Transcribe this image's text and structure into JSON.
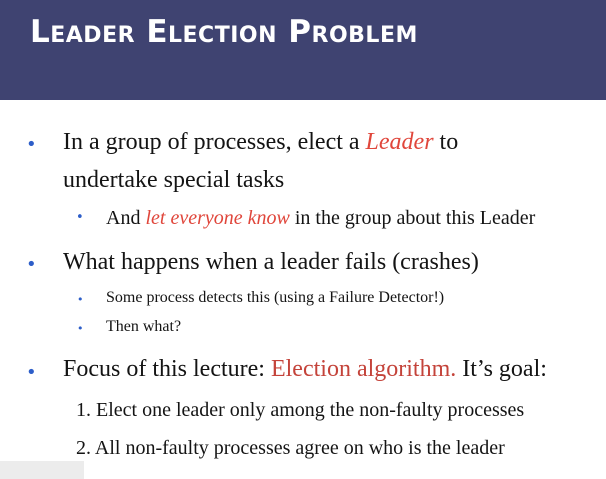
{
  "slide": {
    "title": "Leader Election Problem",
    "bullets": [
      {
        "line1_pre": "In a group of processes, elect a ",
        "line1_emph": "Leader",
        "line1_post": " to",
        "line2": "undertake special tasks"
      },
      {
        "pre": "And ",
        "emph": "let everyone know",
        "post": " in the group about this Leader"
      },
      {
        "text": "What happens when a leader fails (crashes)"
      },
      {
        "text": "Some process detects this (using a Failure Detector!)"
      },
      {
        "text": "Then what?"
      },
      {
        "pre": "Focus of this lecture: ",
        "emph": "Election algorithm.",
        "post": " It’s goal:"
      }
    ],
    "numbered": [
      "1. Elect one leader only among the non-faulty processes",
      "2. All non-faulty processes agree on who is the leader"
    ]
  },
  "colors": {
    "header_bg": "#3f4371",
    "bullet": "#2d5ec9",
    "emphasis": "#e0463b"
  }
}
